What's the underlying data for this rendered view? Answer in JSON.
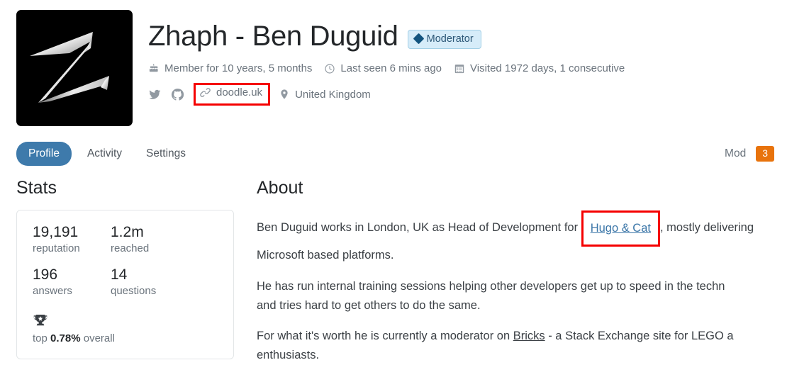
{
  "profile": {
    "username": "Zhaph - Ben Duguid",
    "badge": "Moderator",
    "avatar_alt": "stylized silver Z on black",
    "meta_line1": [
      {
        "icon": "cake-icon",
        "text": "Member for 10 years, 5 months"
      },
      {
        "icon": "clock-icon",
        "text": "Last seen 6 mins ago"
      },
      {
        "icon": "calendar-icon",
        "text": "Visited 1972 days, 1 consecutive"
      }
    ],
    "meta_line2": {
      "twitter_icon": "twitter-icon",
      "github_icon": "github-icon",
      "website": "doodle.uk",
      "website_icon": "link-icon",
      "location": "United Kingdom",
      "location_icon": "map-pin-icon"
    }
  },
  "tabs": {
    "profile": "Profile",
    "activity": "Activity",
    "settings": "Settings",
    "mod_label": "Mod",
    "mod_count": "3"
  },
  "stats": {
    "title": "Stats",
    "reputation_value": "19,191",
    "reputation_label": "reputation",
    "reached_value": "1.2m",
    "reached_label": "reached",
    "answers_value": "196",
    "answers_label": "answers",
    "questions_value": "14",
    "questions_label": "questions",
    "trophy_icon": "trophy-icon",
    "top_prefix": "top ",
    "top_percent": "0.78%",
    "top_suffix": " overall"
  },
  "about": {
    "title": "About",
    "p1_before": "Ben Duguid works in London, UK as Head of Development for ",
    "p1_link": "Hugo & Cat",
    "p1_after": ", mostly delivering",
    "p1_line2": "Microsoft based platforms.",
    "p2_line1": "He has run internal training sessions helping other developers get up to speed in the techn",
    "p2_line2": "and tries hard to get others to do the same.",
    "p3_before": "For what it's worth he is currently a moderator on ",
    "p3_link": "Bricks",
    "p3_after": " - a Stack Exchange site for LEGO a",
    "p3_line2": "enthusiasts."
  },
  "colors": {
    "accent_blue": "#3e7aab",
    "badge_orange": "#e8730c",
    "moderator_bg": "#d6ecf9",
    "moderator_fg": "#12537e",
    "highlight_red": "#f50000",
    "link_blue": "#3b76a8",
    "muted_text": "#6a737c"
  }
}
